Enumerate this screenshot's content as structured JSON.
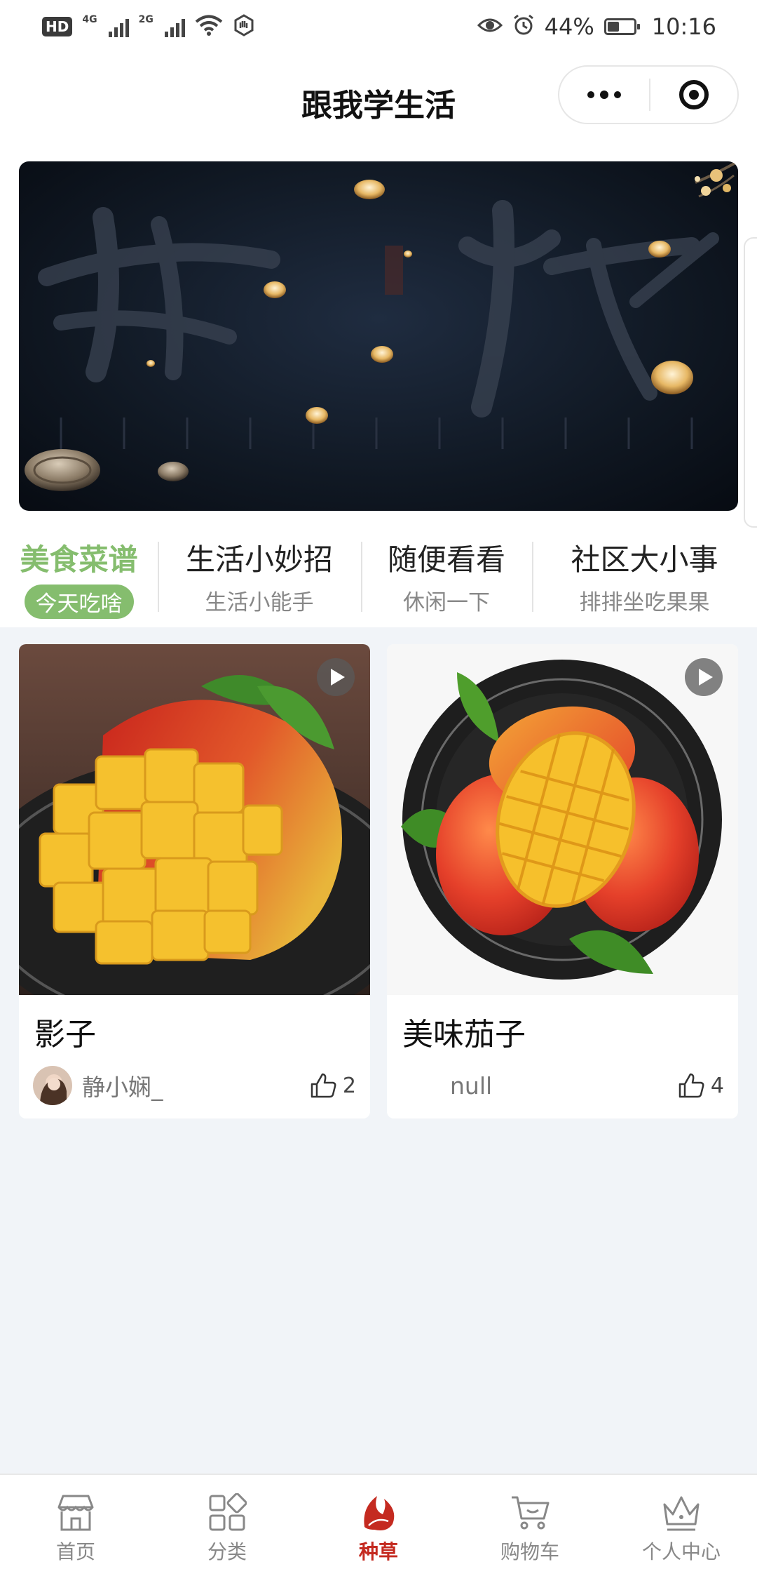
{
  "status_bar": {
    "hd": "HD",
    "net1": "4G",
    "net2": "2G",
    "battery_text": "44%",
    "battery_level": 0.44,
    "time": "10:16",
    "icons": [
      "signal-icon",
      "wifi-icon",
      "hand-icon",
      "eye-icon",
      "alarm-icon",
      "battery-icon"
    ]
  },
  "navbar": {
    "title": "跟我学生活",
    "capsule_icons": [
      "more-icon",
      "close-target-icon"
    ]
  },
  "categories": [
    {
      "title": "美食菜谱",
      "sub": "今天吃啥",
      "active": true
    },
    {
      "title": "生活小妙招",
      "sub": "生活小能手",
      "active": false
    },
    {
      "title": "随便看看",
      "sub": "休闲一下",
      "active": false
    },
    {
      "title": "社区大小事",
      "sub": "排排坐吃果果",
      "active": false
    }
  ],
  "colors": {
    "accent_green": "#85bd6e",
    "tab_active_red": "#c42a20",
    "page_bg": "#f1f4f8"
  },
  "cards": [
    {
      "title": "影子",
      "author": "静小娴_",
      "likes": "2",
      "video": true
    },
    {
      "title": "美味茄子",
      "author": "null",
      "likes": "4",
      "video": true
    }
  ],
  "tabbar": [
    {
      "label": "首页",
      "icon": "store-icon",
      "active": false
    },
    {
      "label": "分类",
      "icon": "grid-icon",
      "active": false
    },
    {
      "label": "种草",
      "icon": "leaf-icon",
      "active": true
    },
    {
      "label": "购物车",
      "icon": "cart-icon",
      "active": false
    },
    {
      "label": "个人中心",
      "icon": "crown-icon",
      "active": false
    }
  ]
}
